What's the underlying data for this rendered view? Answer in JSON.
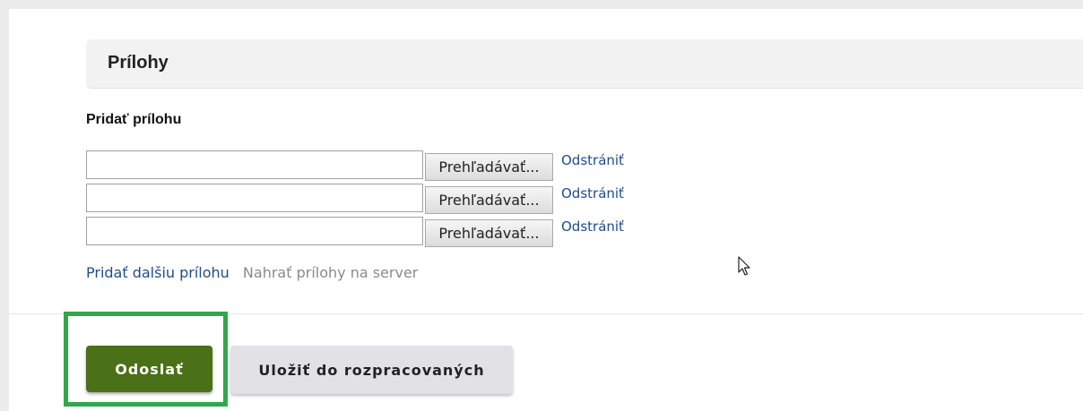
{
  "section": {
    "title": "Prílohy"
  },
  "attachments": {
    "add_label": "Pridať prílohu",
    "rows": [
      {
        "value": "",
        "browse_label": "Prehľadávať...",
        "remove_label": "Odstrániť"
      },
      {
        "value": "",
        "browse_label": "Prehľadávať...",
        "remove_label": "Odstrániť"
      },
      {
        "value": "",
        "browse_label": "Prehľadávať...",
        "remove_label": "Odstrániť"
      }
    ],
    "add_more_label": "Pridať dalšiu prílohu",
    "upload_label": "Nahrať prílohy na server"
  },
  "actions": {
    "send_label": "Odoslať",
    "save_draft_label": "Uložiť do rozpracovaných"
  },
  "colors": {
    "send_button": "#4a7018",
    "highlight": "#2fa84a",
    "link": "#1e4c8c"
  },
  "icons": {
    "pointer": "mouse-pointer-icon"
  }
}
